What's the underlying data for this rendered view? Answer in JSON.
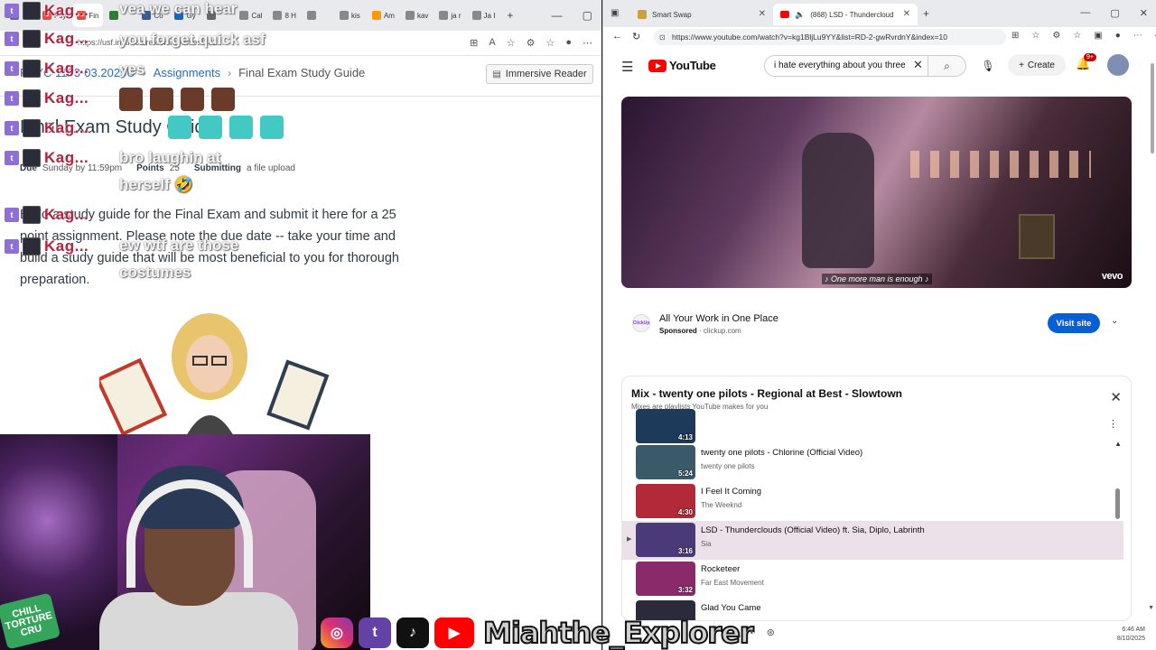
{
  "left_browser": {
    "tabs": [
      {
        "label": "",
        "color": "#6264a7"
      },
      {
        "label": "Psy",
        "color": "#e74c3c"
      },
      {
        "label": "Fin",
        "color": "#e74c3c",
        "active": true
      },
      {
        "label": "",
        "color": "#2e7d32"
      },
      {
        "label": "Co",
        "color": "#3b5998"
      },
      {
        "label": "Gy",
        "color": "#1565c0"
      },
      {
        "label": "",
        "color": "#666"
      },
      {
        "label": "Cal",
        "color": "#888"
      },
      {
        "label": "8 H",
        "color": "#888"
      },
      {
        "label": "",
        "color": "#888"
      },
      {
        "label": "kis",
        "color": "#888"
      },
      {
        "label": "Am",
        "color": "#ff9900"
      },
      {
        "label": "kav",
        "color": "#888"
      },
      {
        "label": "ja r",
        "color": "#888"
      },
      {
        "label": "Ja I",
        "color": "#888"
      }
    ],
    "url": "https://usf.instructure.com/courses/382...",
    "breadcrumb": {
      "course": "PSYC 1103-03.2025U",
      "section": "Assignments",
      "current": "Final Exam Study Guide"
    },
    "immersive_reader": "Immersive Reader",
    "assignment": {
      "title": "Final Exam Study Guide",
      "due_label": "Due",
      "due_value": "Sunday by 11:59pm",
      "points_label": "Points",
      "points_value": "25",
      "submitting_label": "Submitting",
      "submitting_value": "a file upload",
      "body": "Build a study guide for the Final Exam and submit it here for a 25 point assignment. Please note the due date -- take your time and build a study guide that will be most beneficial to you for thorough preparation."
    }
  },
  "chat": {
    "username": "Kag...",
    "messages": [
      "vea we can hear",
      "you forget quick asf",
      "yes",
      "bro laughin at",
      "herself 🤣",
      "ew wtf are those",
      "costumes"
    ]
  },
  "stream": {
    "banner_name": "Miahthe_Explorer",
    "sticker_text": "CHILL TORTURE CRU"
  },
  "right_browser": {
    "tabs": [
      {
        "label": "Smart Swap"
      },
      {
        "label": "(868) LSD - Thunderclouds (",
        "active": true
      }
    ],
    "url": "https://www.youtube.com/watch?v=kg1BljLu9YY&list=RD-2-gwRvrdnY&index=10",
    "youtube": {
      "logo_text": "YouTube",
      "search_value": "i hate everything about you three",
      "create_label": "Create",
      "notification_count": "9+",
      "video_caption": "♪ One more man is enough ♪",
      "video_watermark": "vevo",
      "ad": {
        "logo": "ClickUp",
        "title": "All Your Work in One Place",
        "sponsored": "Sponsored",
        "domain": "clickup.com",
        "cta": "Visit site"
      },
      "playlist": {
        "title": "Mix - twenty one pilots - Regional at Best - Slowtown",
        "subtitle": "Mixes are playlists YouTube makes for you",
        "partial_duration": "4:13",
        "items": [
          {
            "title": "twenty one pilots - Chlorine (Official Video)",
            "channel": "twenty one pilots",
            "duration": "5:24",
            "thumb": "#3a5a6a"
          },
          {
            "title": "I Feel It Coming",
            "channel": "The Weeknd",
            "duration": "4:30",
            "thumb": "#b22a3a"
          },
          {
            "title": "LSD - Thunderclouds (Official Video) ft. Sia, Diplo, Labrinth",
            "channel": "Sia",
            "duration": "3:16",
            "thumb": "#4a3a7a",
            "active": true
          },
          {
            "title": "Rocketeer",
            "channel": "Far East Movement",
            "duration": "3:32",
            "thumb": "#8a2a6a"
          },
          {
            "title": "Glad You Came",
            "channel": "",
            "duration": "",
            "thumb": "#2a2a3a"
          }
        ]
      }
    }
  },
  "clock": {
    "time": "6:46 AM",
    "date": "8/10/2025"
  }
}
